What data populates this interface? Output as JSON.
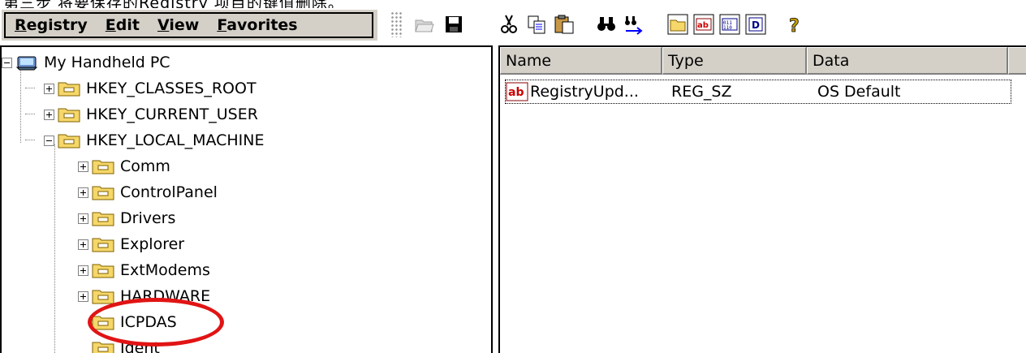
{
  "top_strip_text": "第三步 将要保存的Registry 项目的键值删除。",
  "menu": {
    "items": [
      {
        "label": "Registry",
        "underline": "R",
        "rest": "egistry"
      },
      {
        "label": "Edit",
        "underline": "E",
        "rest": "dit"
      },
      {
        "label": "View",
        "underline": "V",
        "rest": "iew"
      },
      {
        "label": "Favorites",
        "underline": "F",
        "rest": "avorites"
      }
    ]
  },
  "toolbar": {
    "buttons": [
      "open-icon",
      "save-icon",
      "cut-icon",
      "copy-icon",
      "paste-icon",
      "find-icon",
      "find-next-icon",
      "new-key-icon",
      "new-string-icon",
      "new-binary-icon",
      "new-dword-icon",
      "help-icon"
    ]
  },
  "tree": {
    "root": {
      "label": "My Handheld PC",
      "expanded": true
    },
    "hives": [
      {
        "label": "HKEY_CLASSES_ROOT",
        "expanded": false
      },
      {
        "label": "HKEY_CURRENT_USER",
        "expanded": false
      },
      {
        "label": "HKEY_LOCAL_MACHINE",
        "expanded": true
      }
    ],
    "subkeys": [
      {
        "label": "Comm",
        "has_children": true
      },
      {
        "label": "ControlPanel",
        "has_children": true
      },
      {
        "label": "Drivers",
        "has_children": true
      },
      {
        "label": "Explorer",
        "has_children": true
      },
      {
        "label": "ExtModems",
        "has_children": true
      },
      {
        "label": "HARDWARE",
        "has_children": true
      },
      {
        "label": "ICPDAS",
        "has_children": false,
        "selected": true,
        "highlighted": true
      },
      {
        "label": "Ident",
        "has_children": false
      }
    ]
  },
  "list": {
    "columns": [
      "Name",
      "Type",
      "Data"
    ],
    "rows": [
      {
        "name": "RegistryUpd...",
        "type": "REG_SZ",
        "data": "OS Default",
        "icon": "string-value-icon"
      }
    ]
  },
  "colors": {
    "highlight": "#e11414",
    "chrome": "#d4d0c8",
    "folder": "#f5d76a"
  }
}
